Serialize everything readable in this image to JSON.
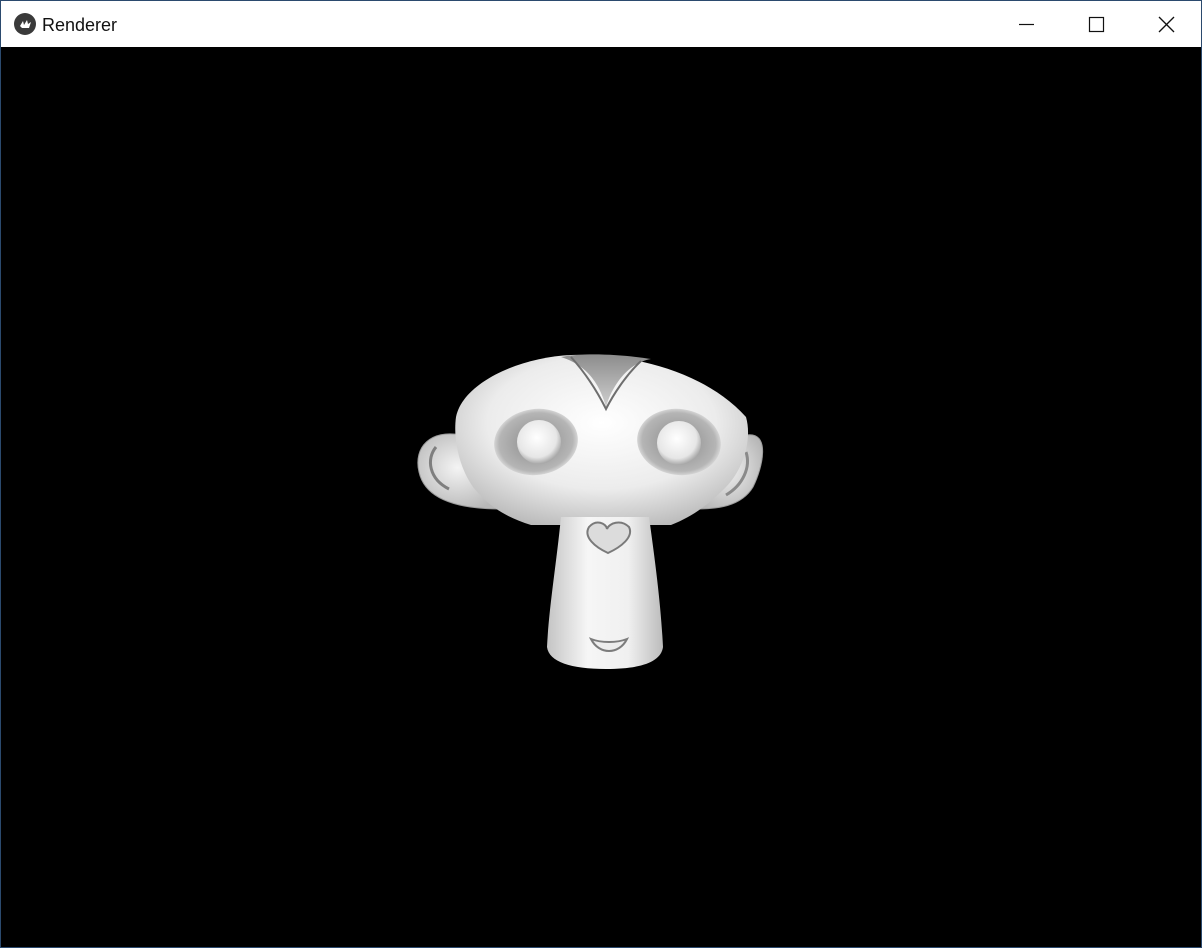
{
  "window": {
    "title": "Renderer",
    "app_icon": "kivy-logo-icon",
    "controls": {
      "minimize": "minimize-icon",
      "maximize": "maximize-icon",
      "close": "close-icon"
    }
  },
  "viewport": {
    "background_color": "#000000",
    "model": "monkey-head-3d-model",
    "model_color": "#e8e8e8"
  }
}
